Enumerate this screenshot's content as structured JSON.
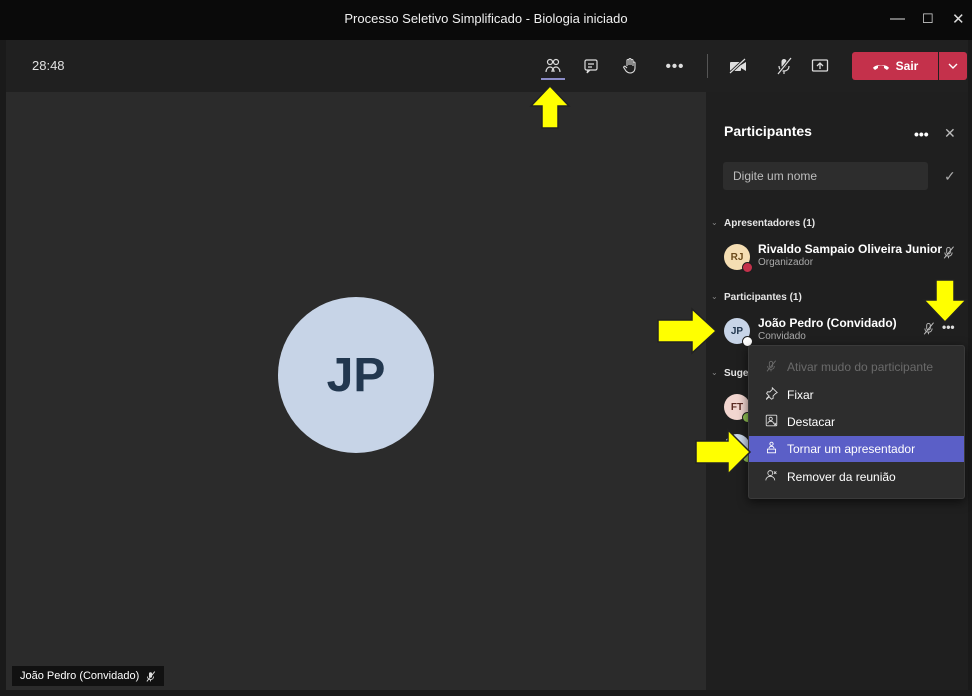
{
  "window": {
    "title": "Processo Seletivo Simplificado - Biologia iniciado"
  },
  "toolbar": {
    "timer": "28:48",
    "leave_label": "Sair"
  },
  "stage": {
    "avatar_initials": "JP",
    "name_chip": "João Pedro (Convidado)"
  },
  "panel": {
    "title": "Participantes",
    "search_placeholder": "Digite um nome",
    "presenters_header": "Apresentadores (1)",
    "participants_header": "Participantes (1)",
    "suggestions_header_partial": "Suge",
    "presenter": {
      "initials": "RJ",
      "name": "Rivaldo Sampaio Oliveira Junior",
      "role": "Organizador"
    },
    "participant": {
      "initials": "JP",
      "name": "João Pedro (Convidado)",
      "role": "Convidado"
    },
    "suggestion_initials": "FT"
  },
  "context_menu": {
    "items": [
      {
        "label": "Ativar mudo do participante",
        "icon": "mute-icon",
        "state": "disabled"
      },
      {
        "label": "Fixar",
        "icon": "pin-icon",
        "state": "normal"
      },
      {
        "label": "Destacar",
        "icon": "spotlight-icon",
        "state": "normal"
      },
      {
        "label": "Tornar um apresentador",
        "icon": "presenter-icon",
        "state": "highlighted"
      },
      {
        "label": "Remover da reunião",
        "icon": "remove-person-icon",
        "state": "normal"
      }
    ]
  },
  "colors": {
    "leave_button": "#c4314b",
    "menu_highlight": "#5b5fc7",
    "annotation_arrow": "#ffff00",
    "avatar_jp": "#c7d4e7"
  }
}
